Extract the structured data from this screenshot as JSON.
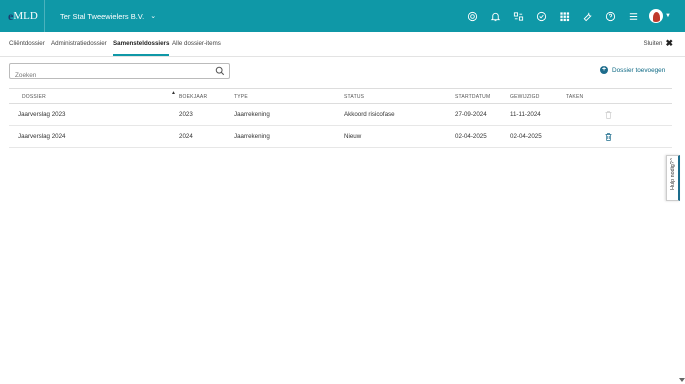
{
  "app": {
    "logo_prefix": "e",
    "logo_text": "MLD",
    "org_name": "Ter Stal Tweewielers B.V."
  },
  "header_icons": [
    "target-icon",
    "bell-icon",
    "transfer-icon",
    "check-circle-icon",
    "apps-grid-icon",
    "wrench-icon",
    "help-icon",
    "menu-icon"
  ],
  "tabs": [
    {
      "label": "Cliëntdossier",
      "active": false
    },
    {
      "label": "Administratiedossier",
      "active": false
    },
    {
      "label": "Samensteldossiers",
      "active": true
    },
    {
      "label": "Alle dossier-items",
      "active": false
    }
  ],
  "close_label": "Sluiten",
  "search": {
    "placeholder": "Zoeken",
    "value": ""
  },
  "add_button_label": "Dossier toevoegen",
  "table": {
    "columns": [
      "DOSSIER",
      "BOEKJAAR",
      "TYPE",
      "STATUS",
      "STARTDATUM",
      "GEWIJZIGD",
      "TAKEN"
    ],
    "rows": [
      {
        "dossier": "Jaarverslag 2023",
        "boekjaar": "2023",
        "type": "Jaarrekening",
        "status": "Akkoord risicofase",
        "startdatum": "27-09-2024",
        "gewijzigd": "11-11-2024",
        "taken": "",
        "delete_enabled": false
      },
      {
        "dossier": "Jaarverslag 2024",
        "boekjaar": "2024",
        "type": "Jaarrekening",
        "status": "Nieuw",
        "startdatum": "02-04-2025",
        "gewijzigd": "02-04-2025",
        "taken": "",
        "delete_enabled": true
      }
    ]
  },
  "help_tab_label": "Hulp nodig?",
  "colors": {
    "topbar": "#0f98a7",
    "accent": "#1d6c8c"
  }
}
